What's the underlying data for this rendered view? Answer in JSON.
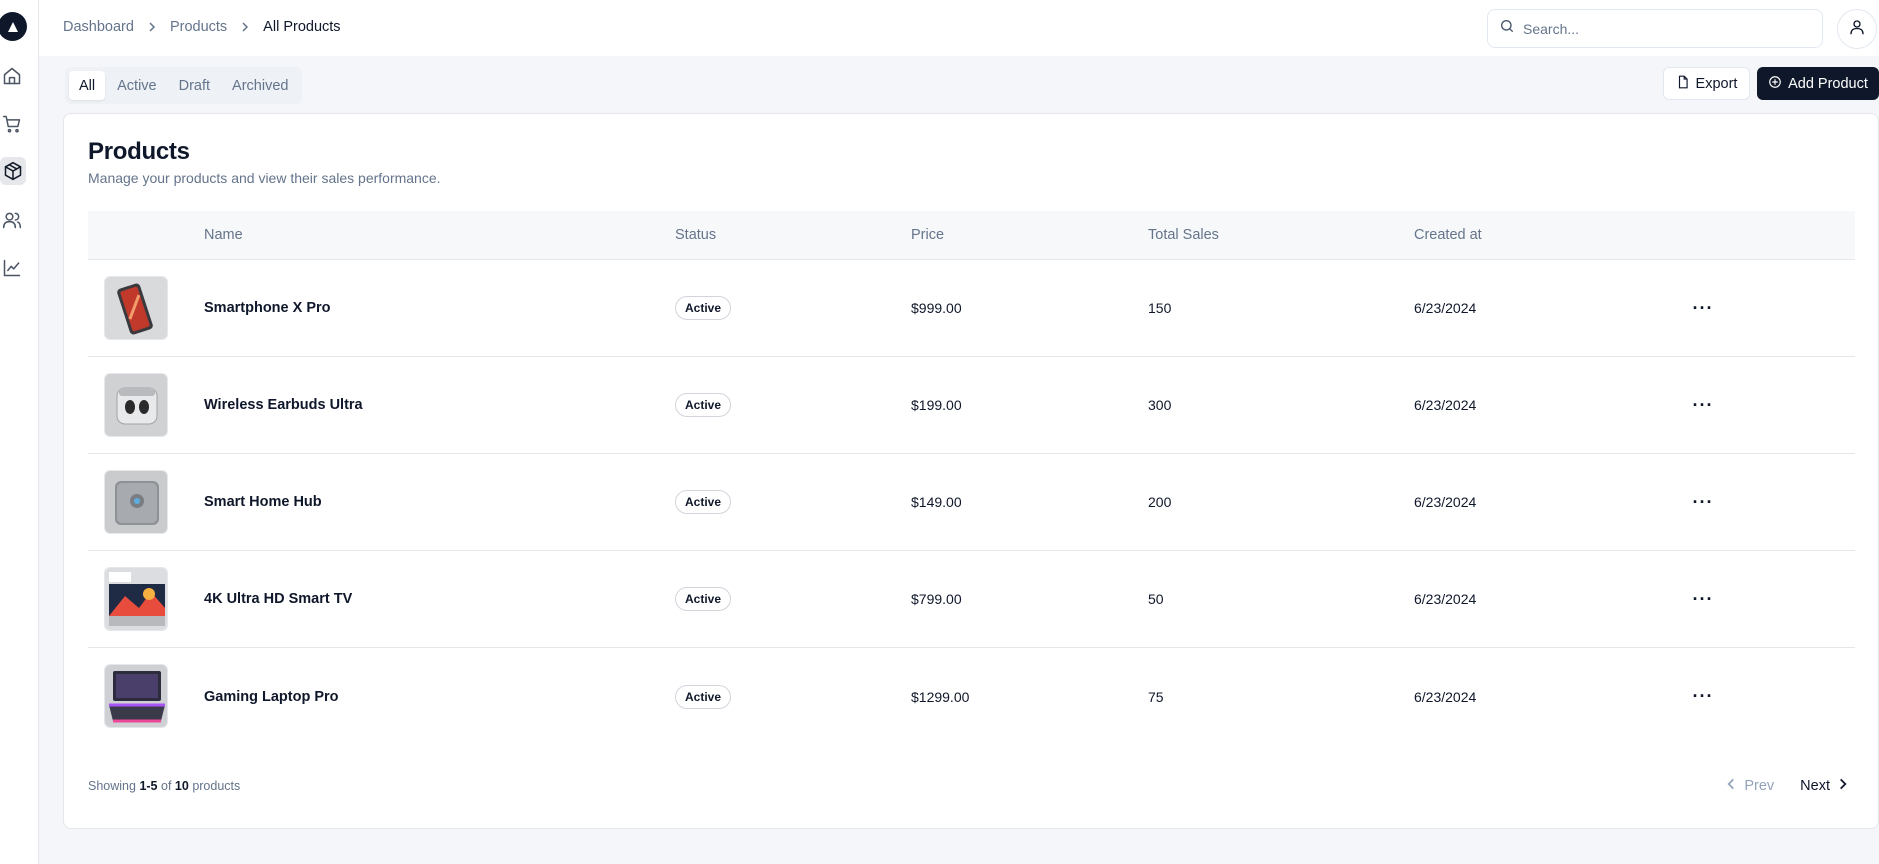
{
  "sidebar": {
    "items": [
      {
        "icon": "home-icon"
      },
      {
        "icon": "shopping-cart-icon"
      },
      {
        "icon": "package-icon"
      },
      {
        "icon": "users-icon"
      },
      {
        "icon": "line-chart-icon"
      }
    ],
    "active_index": 2
  },
  "header": {
    "breadcrumb": [
      "Dashboard",
      "Products",
      "All Products"
    ],
    "search_placeholder": "Search..."
  },
  "tabs": [
    "All",
    "Active",
    "Draft",
    "Archived"
  ],
  "actions": {
    "export_label": "Export",
    "add_label": "Add Product"
  },
  "card": {
    "title": "Products",
    "description": "Manage your products and view their sales performance."
  },
  "table": {
    "columns": [
      "Name",
      "Status",
      "Price",
      "Total Sales",
      "Created at"
    ],
    "rows": [
      {
        "name": "Smartphone X Pro",
        "status": "Active",
        "price": "$999.00",
        "sales": "150",
        "created": "6/23/2024"
      },
      {
        "name": "Wireless Earbuds Ultra",
        "status": "Active",
        "price": "$199.00",
        "sales": "300",
        "created": "6/23/2024"
      },
      {
        "name": "Smart Home Hub",
        "status": "Active",
        "price": "$149.00",
        "sales": "200",
        "created": "6/23/2024"
      },
      {
        "name": "4K Ultra HD Smart TV",
        "status": "Active",
        "price": "$799.00",
        "sales": "50",
        "created": "6/23/2024"
      },
      {
        "name": "Gaming Laptop Pro",
        "status": "Active",
        "price": "$1299.00",
        "sales": "75",
        "created": "6/23/2024"
      }
    ]
  },
  "footer": {
    "showing_prefix": "Showing",
    "range": "1-5",
    "of": "of",
    "total": "10",
    "suffix": "products",
    "prev_label": "Prev",
    "next_label": "Next"
  },
  "colors": {
    "primary": "#0f172a",
    "muted": "#64748b",
    "border": "#e5e7eb",
    "page_bg": "#f4f6f9"
  }
}
